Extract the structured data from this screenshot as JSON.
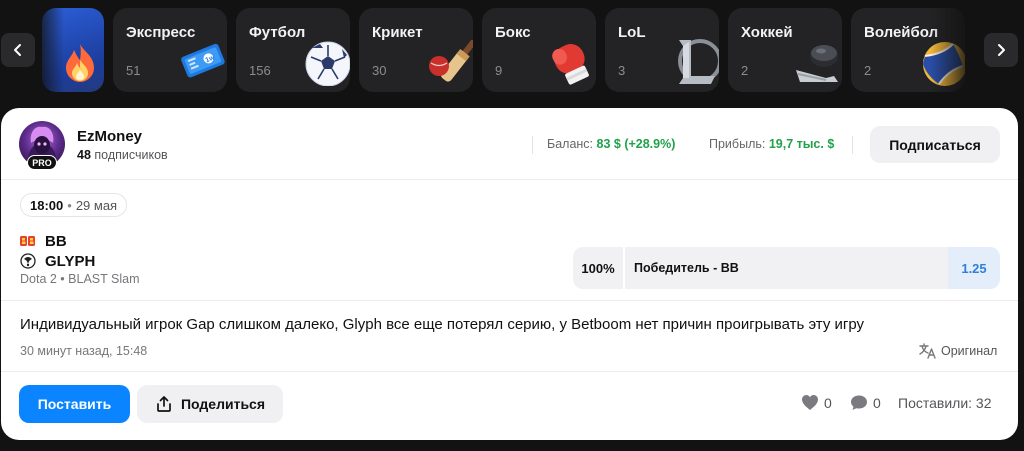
{
  "categories": [
    {
      "name": "",
      "count": "",
      "icon": "fire-icon"
    },
    {
      "name": "Экспресс",
      "count": "51",
      "icon": "ticket-icon"
    },
    {
      "name": "Футбол",
      "count": "156",
      "icon": "football-icon"
    },
    {
      "name": "Крикет",
      "count": "30",
      "icon": "cricket-icon"
    },
    {
      "name": "Бокс",
      "count": "9",
      "icon": "boxing-glove-icon"
    },
    {
      "name": "LoL",
      "count": "3",
      "icon": "lol-logo-icon"
    },
    {
      "name": "Хоккей",
      "count": "2",
      "icon": "hockey-icon"
    },
    {
      "name": "Волейбол",
      "count": "2",
      "icon": "volleyball-icon"
    }
  ],
  "post": {
    "author": {
      "name": "EzMoney",
      "badge": "PRO",
      "subscribers_count": "48",
      "subscribers_label": "подписчиков"
    },
    "stats": {
      "balance_label": "Баланс:",
      "balance_value": "83 $ (+28.9%)",
      "profit_label": "Прибыль:",
      "profit_value": "19,7 тыс. $"
    },
    "subscribe_label": "Подписаться",
    "event": {
      "time": "18:00",
      "separator": "•",
      "date": "29 мая",
      "team1": "BB",
      "team2": "GLYPH",
      "league": "Dota 2 • BLAST Slam"
    },
    "bet": {
      "percent": "100%",
      "pick": "Победитель - BB",
      "odds": "1.25"
    },
    "comment": "Индивидуальный игрок Gap слишком далеко, Glyph все еще потерял серию, у Betboom нет причин проигрывать эту игру",
    "posted": "30 минут назад, 15:48",
    "original_label": "Оригинал",
    "actions": {
      "place_label": "Поставить",
      "share_label": "Поделиться",
      "likes": "0",
      "comments": "0",
      "placed_text": "Поставили: 32"
    }
  },
  "colors": {
    "page_bg": "#121212",
    "tile_bg": "#232325",
    "accent_blue": "#0a84ff",
    "positive_green": "#1fa24a",
    "odds_blue": "#2f80d8"
  }
}
